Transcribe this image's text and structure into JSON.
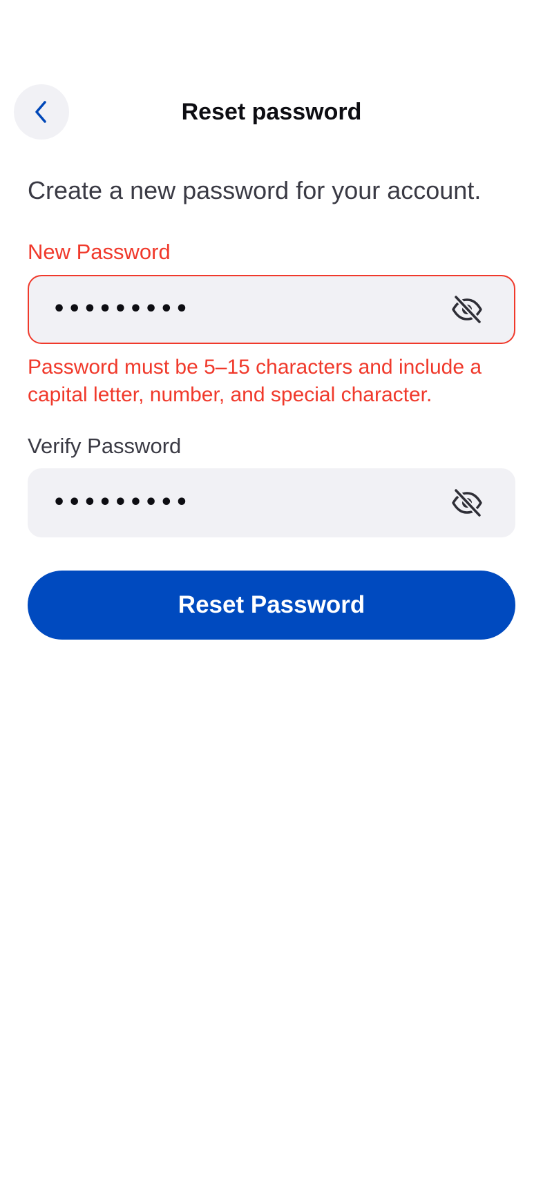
{
  "header": {
    "title": "Reset password",
    "back_icon": "chevron-left-icon"
  },
  "form": {
    "subtitle": "Create a new password for your account.",
    "new_password": {
      "label": "New Password",
      "value": "•••••••••",
      "visibility_icon": "eye-off-icon",
      "error": "Password must be 5–15 characters and include a capital letter, number, and special character."
    },
    "verify_password": {
      "label": "Verify Password",
      "value": "•••••••••",
      "visibility_icon": "eye-off-icon"
    },
    "submit_label": "Reset Password"
  },
  "colors": {
    "primary": "#004abf",
    "error": "#f0392b",
    "field_background": "#f1f1f5"
  }
}
